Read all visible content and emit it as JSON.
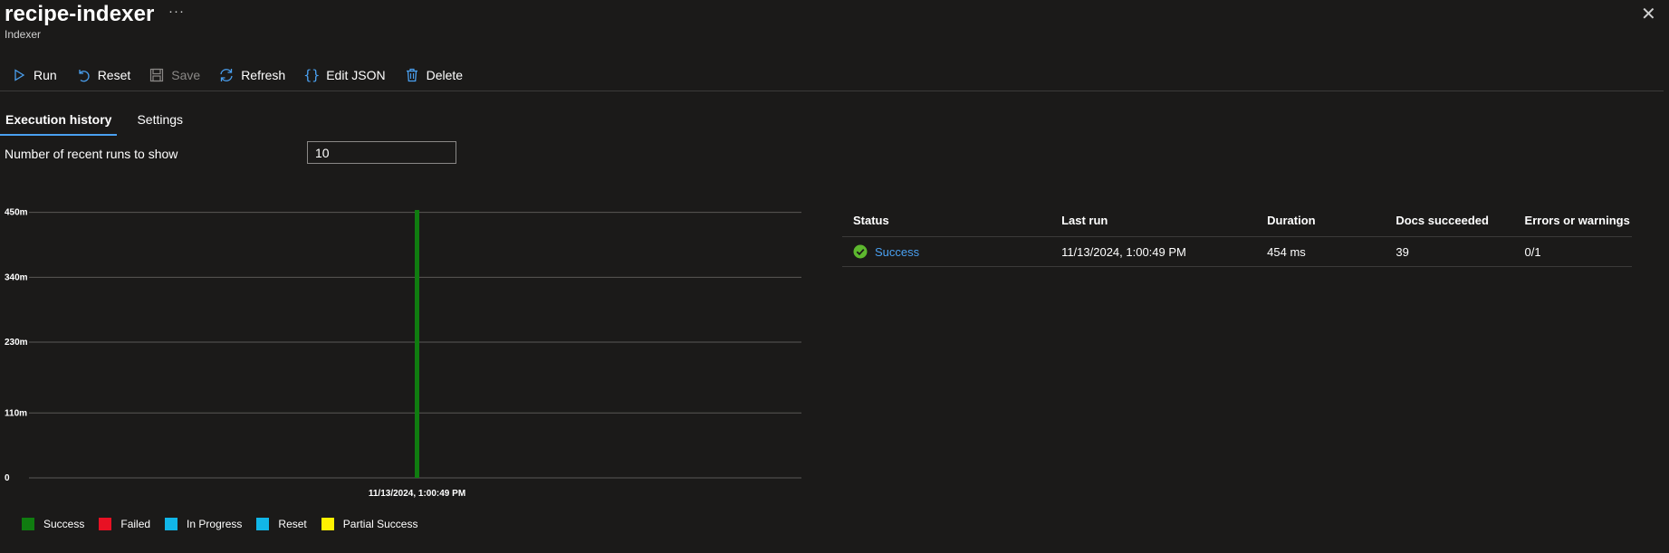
{
  "header": {
    "title": "recipe-indexer",
    "subtitle": "Indexer",
    "more_label": "···",
    "close_label": "✕"
  },
  "toolbar": {
    "run": "Run",
    "reset": "Reset",
    "save": "Save",
    "refresh": "Refresh",
    "edit_json": "Edit JSON",
    "delete": "Delete"
  },
  "tabs": [
    {
      "label": "Execution history",
      "active": true
    },
    {
      "label": "Settings",
      "active": false
    }
  ],
  "runs": {
    "label": "Number of recent runs to show",
    "value": "10"
  },
  "chart_data": {
    "type": "bar",
    "categories": [
      "11/13/2024, 1:00:49 PM"
    ],
    "series": [
      {
        "name": "Success",
        "values": [
          454
        ],
        "color": "#107c10"
      }
    ],
    "ylim": [
      0,
      454
    ],
    "yticks": [
      0,
      110,
      230,
      340,
      450
    ],
    "ytick_labels": [
      "0",
      "110m",
      "230m",
      "340m",
      "450m"
    ],
    "grid": true,
    "legend_position": "bottom-left",
    "legend": [
      {
        "name": "Success",
        "color": "#107c10"
      },
      {
        "name": "Failed",
        "color": "#e81123"
      },
      {
        "name": "In Progress",
        "color": "#11b6e8"
      },
      {
        "name": "Reset",
        "color": "#11b6e8"
      },
      {
        "name": "Partial Success",
        "color": "#fff100"
      }
    ]
  },
  "table": {
    "headers": [
      "Status",
      "Last run",
      "Duration",
      "Docs succeeded",
      "Errors or warnings"
    ],
    "rows": [
      {
        "status": "Success",
        "last_run": "11/13/2024, 1:00:49 PM",
        "duration": "454 ms",
        "docs": "39",
        "errors": "0/1"
      }
    ]
  },
  "colors": {
    "accent": "#4aa0f0",
    "background": "#1b1a19",
    "success": "#107c10",
    "success_icon": "#5db82e"
  }
}
